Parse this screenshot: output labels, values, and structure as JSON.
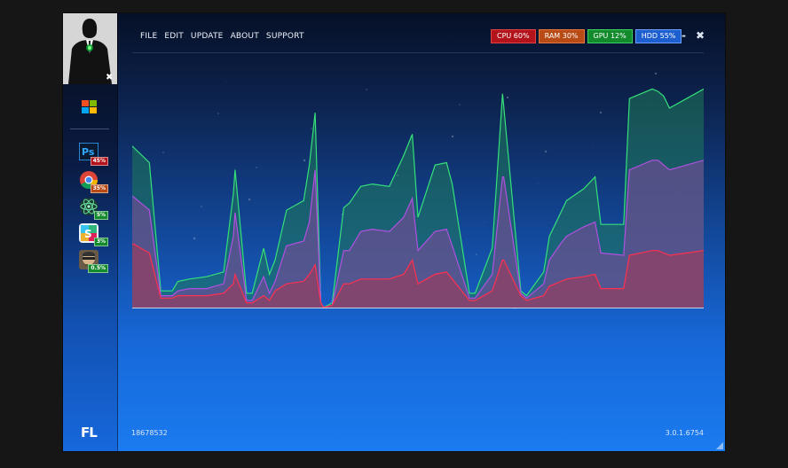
{
  "menu": [
    "FILE",
    "EDIT",
    "UPDATE",
    "ABOUT",
    "SUPPORT"
  ],
  "stats": [
    {
      "label": "CPU 60%",
      "color": "#b3141c",
      "border": "#e04248"
    },
    {
      "label": "RAM 30%",
      "color": "#b84a15",
      "border": "#e6783c"
    },
    {
      "label": "GPU 12%",
      "color": "#138a2c",
      "border": "#3fcf63"
    },
    {
      "label": "HDD 55%",
      "color": "#1d5fcf",
      "border": "#6aa0ff"
    }
  ],
  "window_controls": {
    "minimize": "-",
    "close": "✖"
  },
  "sidebar": {
    "avatar_close": "✖",
    "logo": "FL",
    "apps": [
      {
        "icon": "photoshop-icon",
        "badge": "45%",
        "badge_color": "#b3141c"
      },
      {
        "icon": "chrome-icon",
        "badge": "35%",
        "badge_color": "#b84a15"
      },
      {
        "icon": "atom-icon",
        "badge": "5%",
        "badge_color": "#138a2c"
      },
      {
        "icon": "slack-icon",
        "badge": "3%",
        "badge_color": "#138a2c"
      },
      {
        "icon": "game-avatar-icon",
        "badge": "0.5%",
        "badge_color": "#138a2c"
      }
    ]
  },
  "footer": {
    "left": "18678532",
    "right": "3.0.1.6754"
  },
  "chart_data": {
    "type": "area",
    "ylim": [
      0,
      100
    ],
    "x": [
      0,
      3,
      5,
      7,
      8,
      10,
      13,
      16,
      17.7,
      18,
      20,
      21,
      23,
      24,
      25,
      27,
      30,
      31,
      32,
      33,
      33.5,
      35,
      37,
      38,
      40,
      42,
      45,
      47.5,
      49,
      50,
      53,
      55,
      56,
      59,
      60,
      63,
      64.8,
      65,
      68,
      69,
      72,
      73,
      75,
      76,
      79,
      81,
      82,
      86,
      87,
      91,
      92,
      93,
      94,
      97,
      100
    ],
    "series": [
      {
        "name": "green",
        "color": "#35e07a",
        "fill": "#1f7a5a",
        "values": [
          68,
          61,
          7,
          7,
          11,
          12,
          13,
          15,
          48,
          58,
          6,
          6,
          25,
          14,
          20,
          41,
          45,
          60,
          82,
          2,
          0,
          2,
          42,
          44,
          51,
          52,
          51,
          64,
          73,
          38,
          60,
          61,
          52,
          6,
          6,
          25,
          90,
          85,
          7,
          5,
          15,
          30,
          40,
          45,
          50,
          55,
          35,
          35,
          88,
          92,
          91,
          89,
          84,
          88,
          92
        ]
      },
      {
        "name": "purple",
        "color": "#b050e0",
        "fill": "#7a4a9a",
        "values": [
          47,
          41,
          5,
          5,
          7,
          8,
          8,
          10,
          30,
          40,
          3,
          3,
          13,
          6,
          11,
          26,
          28,
          36,
          58,
          2,
          0,
          1,
          24,
          24,
          32,
          33,
          32,
          38,
          46,
          24,
          32,
          33,
          26,
          4,
          4,
          14,
          55,
          55,
          6,
          4,
          10,
          20,
          27,
          30,
          34,
          36,
          23,
          22,
          58,
          62,
          62,
          60,
          58,
          60,
          62
        ]
      },
      {
        "name": "red",
        "color": "#ff3050",
        "fill": "#a03a5a",
        "values": [
          27,
          23,
          4,
          4,
          5,
          5,
          5,
          6,
          10,
          14,
          2,
          2,
          5,
          3,
          7,
          10,
          11,
          14,
          18,
          2,
          0,
          1,
          10,
          10,
          12,
          12,
          12,
          14,
          20,
          10,
          14,
          15,
          12,
          3,
          3,
          7,
          20,
          20,
          5,
          3,
          5,
          9,
          11,
          12,
          13,
          14,
          8,
          8,
          22,
          24,
          24,
          23,
          22,
          23,
          24
        ]
      }
    ]
  }
}
